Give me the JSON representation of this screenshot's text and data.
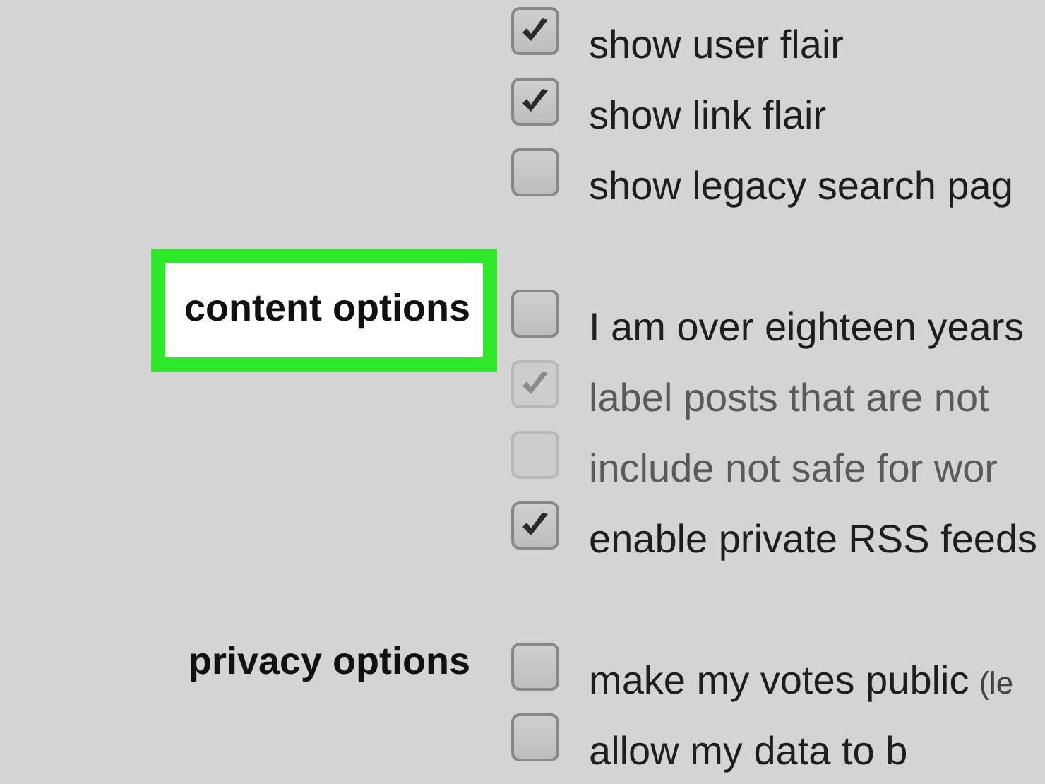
{
  "sections": [
    {
      "options": [
        {
          "label": "show user flair",
          "checked": true,
          "disabled": false
        },
        {
          "label": "show link flair",
          "checked": true,
          "disabled": false
        },
        {
          "label": "show legacy search pag",
          "checked": false,
          "disabled": false
        }
      ]
    },
    {
      "heading": "content options",
      "highlighted": true,
      "options": [
        {
          "label": "I am over eighteen years",
          "checked": false,
          "disabled": false
        },
        {
          "label": "label posts that are not",
          "checked": true,
          "disabled": true
        },
        {
          "label": "include not safe for wor",
          "checked": false,
          "disabled": true
        },
        {
          "label": "enable private RSS feeds",
          "checked": true,
          "disabled": false
        }
      ]
    },
    {
      "heading": "privacy options",
      "highlighted": false,
      "options": [
        {
          "label": "make my votes public",
          "note": "(le",
          "checked": false,
          "disabled": false
        },
        {
          "label": "allow my data to b",
          "checked": false,
          "disabled": false
        }
      ]
    }
  ]
}
